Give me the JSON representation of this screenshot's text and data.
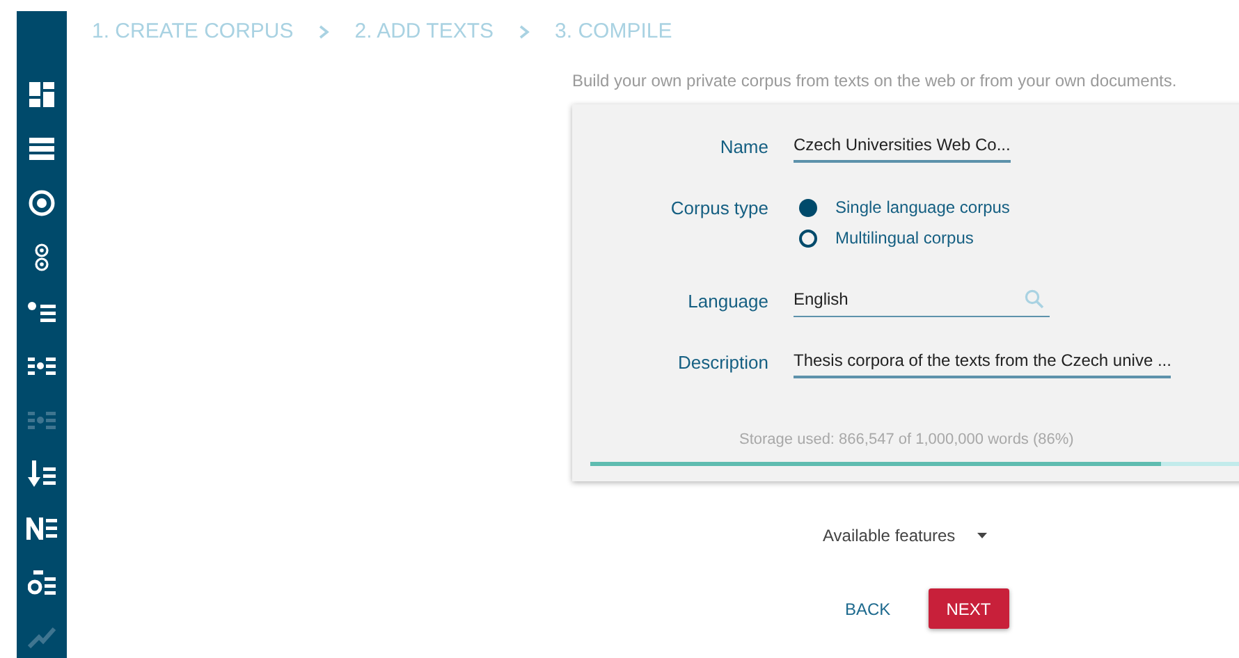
{
  "sidebar": {
    "items": [
      {
        "disabled": false
      },
      {
        "disabled": false
      },
      {
        "disabled": false
      },
      {
        "disabled": false
      },
      {
        "disabled": false
      },
      {
        "disabled": false
      },
      {
        "disabled": true
      },
      {
        "disabled": false
      },
      {
        "disabled": false
      },
      {
        "disabled": false
      },
      {
        "disabled": true
      }
    ]
  },
  "steps": [
    {
      "label": "1. CREATE CORPUS"
    },
    {
      "label": "2. ADD TEXTS"
    },
    {
      "label": "3. COMPILE"
    }
  ],
  "intro": "Build your own private corpus from texts on the web or from your own documents.",
  "form": {
    "name": {
      "label": "Name",
      "value": "Czech Universities Web Co..."
    },
    "corpus_type": {
      "label": "Corpus type",
      "options": [
        {
          "label": "Single language corpus",
          "selected": true
        },
        {
          "label": "Multilingual corpus",
          "selected": false
        }
      ]
    },
    "language": {
      "label": "Language",
      "value": "English"
    },
    "description": {
      "label": "Description",
      "value": "Thesis corpora of the texts from the Czech unive ..."
    },
    "storage": {
      "text": "Storage used: 866,547 of 1,000,000 words (86%)",
      "level": 0.86
    }
  },
  "features_dropdown": "Available features",
  "buttons": [
    {
      "kind": "text",
      "label": "BACK"
    },
    {
      "kind": "primary",
      "label": "NEXT"
    }
  ]
}
